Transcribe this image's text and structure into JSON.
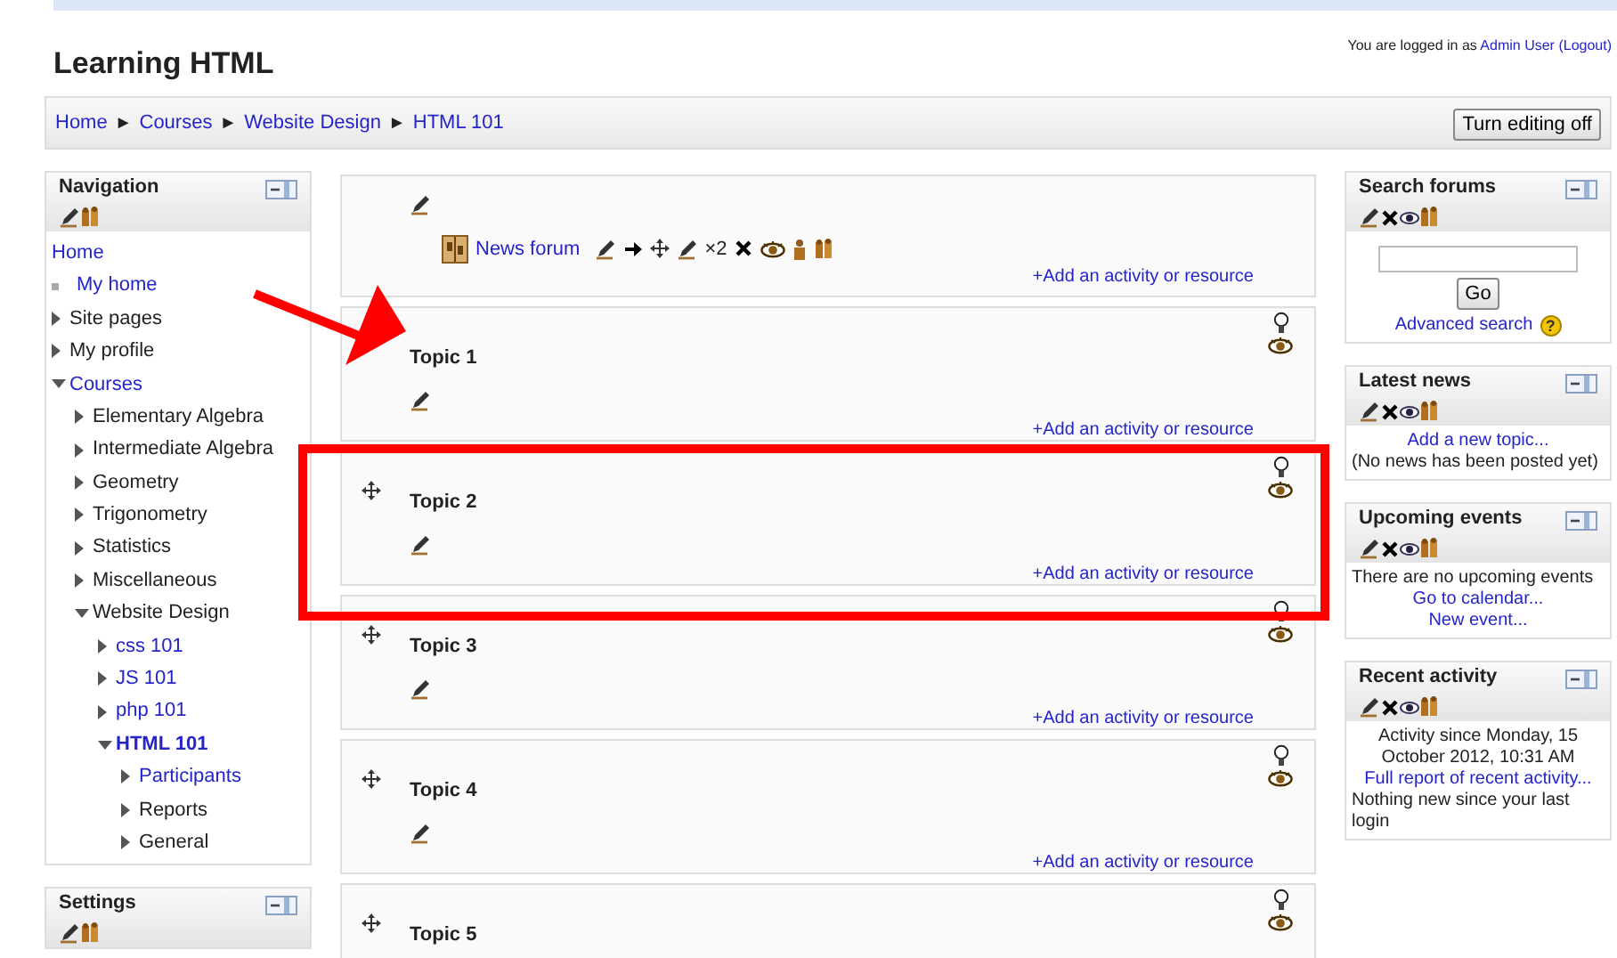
{
  "header": {
    "title": "Learning HTML",
    "login_prefix": "You are logged in as",
    "user": "Admin User",
    "logout": "(Logout)"
  },
  "breadcrumb": {
    "separator": "►",
    "items": [
      "Home",
      "Courses",
      "Website Design",
      "HTML 101"
    ],
    "button": "Turn editing off"
  },
  "left_blocks": [
    {
      "title": "Navigation",
      "deletable": false,
      "kind": "navigation",
      "tree": [
        {
          "label": "Home",
          "kind": "root",
          "link": true,
          "active": false
        },
        {
          "label": "My home",
          "kind": "leaf",
          "link": true,
          "active": false
        },
        {
          "label": "Site pages",
          "kind": "branch",
          "expanded": false,
          "link": false,
          "active": false
        },
        {
          "label": "My profile",
          "kind": "branch",
          "expanded": false,
          "link": false,
          "active": false
        },
        {
          "label": "Courses",
          "kind": "branch",
          "expanded": true,
          "link": true,
          "active": false,
          "children": [
            {
              "label": "Elementary Algebra",
              "kind": "branch",
              "expanded": false,
              "link": false,
              "active": false
            },
            {
              "label": "Intermediate Algebra",
              "kind": "branch",
              "expanded": false,
              "link": false,
              "active": false
            },
            {
              "label": "Geometry",
              "kind": "branch",
              "expanded": false,
              "link": false,
              "active": false
            },
            {
              "label": "Trigonometry",
              "kind": "branch",
              "expanded": false,
              "link": false,
              "active": false
            },
            {
              "label": "Statistics",
              "kind": "branch",
              "expanded": false,
              "link": false,
              "active": false
            },
            {
              "label": "Miscellaneous",
              "kind": "branch",
              "expanded": false,
              "link": false,
              "active": false
            },
            {
              "label": "Website Design",
              "kind": "branch",
              "expanded": true,
              "link": false,
              "active": false,
              "children": [
                {
                  "label": "css 101",
                  "kind": "branch",
                  "expanded": false,
                  "link": true,
                  "active": false
                },
                {
                  "label": "JS 101",
                  "kind": "branch",
                  "expanded": false,
                  "link": true,
                  "active": false
                },
                {
                  "label": "php 101",
                  "kind": "branch",
                  "expanded": false,
                  "link": true,
                  "active": false
                },
                {
                  "label": "HTML 101",
                  "kind": "branch",
                  "expanded": true,
                  "link": true,
                  "active": true,
                  "children": [
                    {
                      "label": "Participants",
                      "kind": "branch",
                      "expanded": false,
                      "link": true,
                      "active": false
                    },
                    {
                      "label": "Reports",
                      "kind": "branch",
                      "expanded": false,
                      "link": false,
                      "active": false
                    },
                    {
                      "label": "General",
                      "kind": "branch",
                      "expanded": false,
                      "link": false,
                      "active": false
                    }
                  ]
                }
              ]
            }
          ]
        }
      ]
    },
    {
      "title": "Settings",
      "deletable": false,
      "kind": "empty"
    }
  ],
  "sections": [
    {
      "kind": "intro",
      "activity": {
        "name": "News forum",
        "indent_label": "×2"
      },
      "add_link": "+Add an activity or resource"
    },
    {
      "kind": "topic",
      "title": "Topic 1",
      "movable": false,
      "add_link": "+Add an activity or resource"
    },
    {
      "kind": "topic",
      "title": "Topic 2",
      "movable": true,
      "add_link": "+Add an activity or resource"
    },
    {
      "kind": "topic",
      "title": "Topic 3",
      "movable": true,
      "add_link": "+Add an activity or resource"
    },
    {
      "kind": "topic",
      "title": "Topic 4",
      "movable": true,
      "add_link": "+Add an activity or resource"
    },
    {
      "kind": "topic",
      "title": "Topic 5",
      "movable": true
    }
  ],
  "right_blocks": [
    {
      "title": "Search forums",
      "deletable": true,
      "kind": "search",
      "button": "Go",
      "link": "Advanced search",
      "help": "?"
    },
    {
      "title": "Latest news",
      "deletable": true,
      "kind": "lines",
      "lines": [
        {
          "kind": "link",
          "text": "Add a new topic..."
        },
        {
          "kind": "text",
          "text": "(No news has been posted yet)"
        }
      ]
    },
    {
      "title": "Upcoming events",
      "deletable": true,
      "kind": "lines",
      "lines": [
        {
          "kind": "text",
          "text": "There are no upcoming events"
        },
        {
          "kind": "link",
          "text": "Go to calendar..."
        },
        {
          "kind": "link",
          "text": "New event..."
        }
      ]
    },
    {
      "title": "Recent activity",
      "deletable": true,
      "kind": "lines",
      "lines": [
        {
          "kind": "note",
          "text": "Activity since Monday, 15 October 2012, 10:31 AM"
        },
        {
          "kind": "link",
          "text": "Full report of recent activity..."
        },
        {
          "kind": "text",
          "text": "Nothing new since your last login"
        }
      ]
    }
  ]
}
